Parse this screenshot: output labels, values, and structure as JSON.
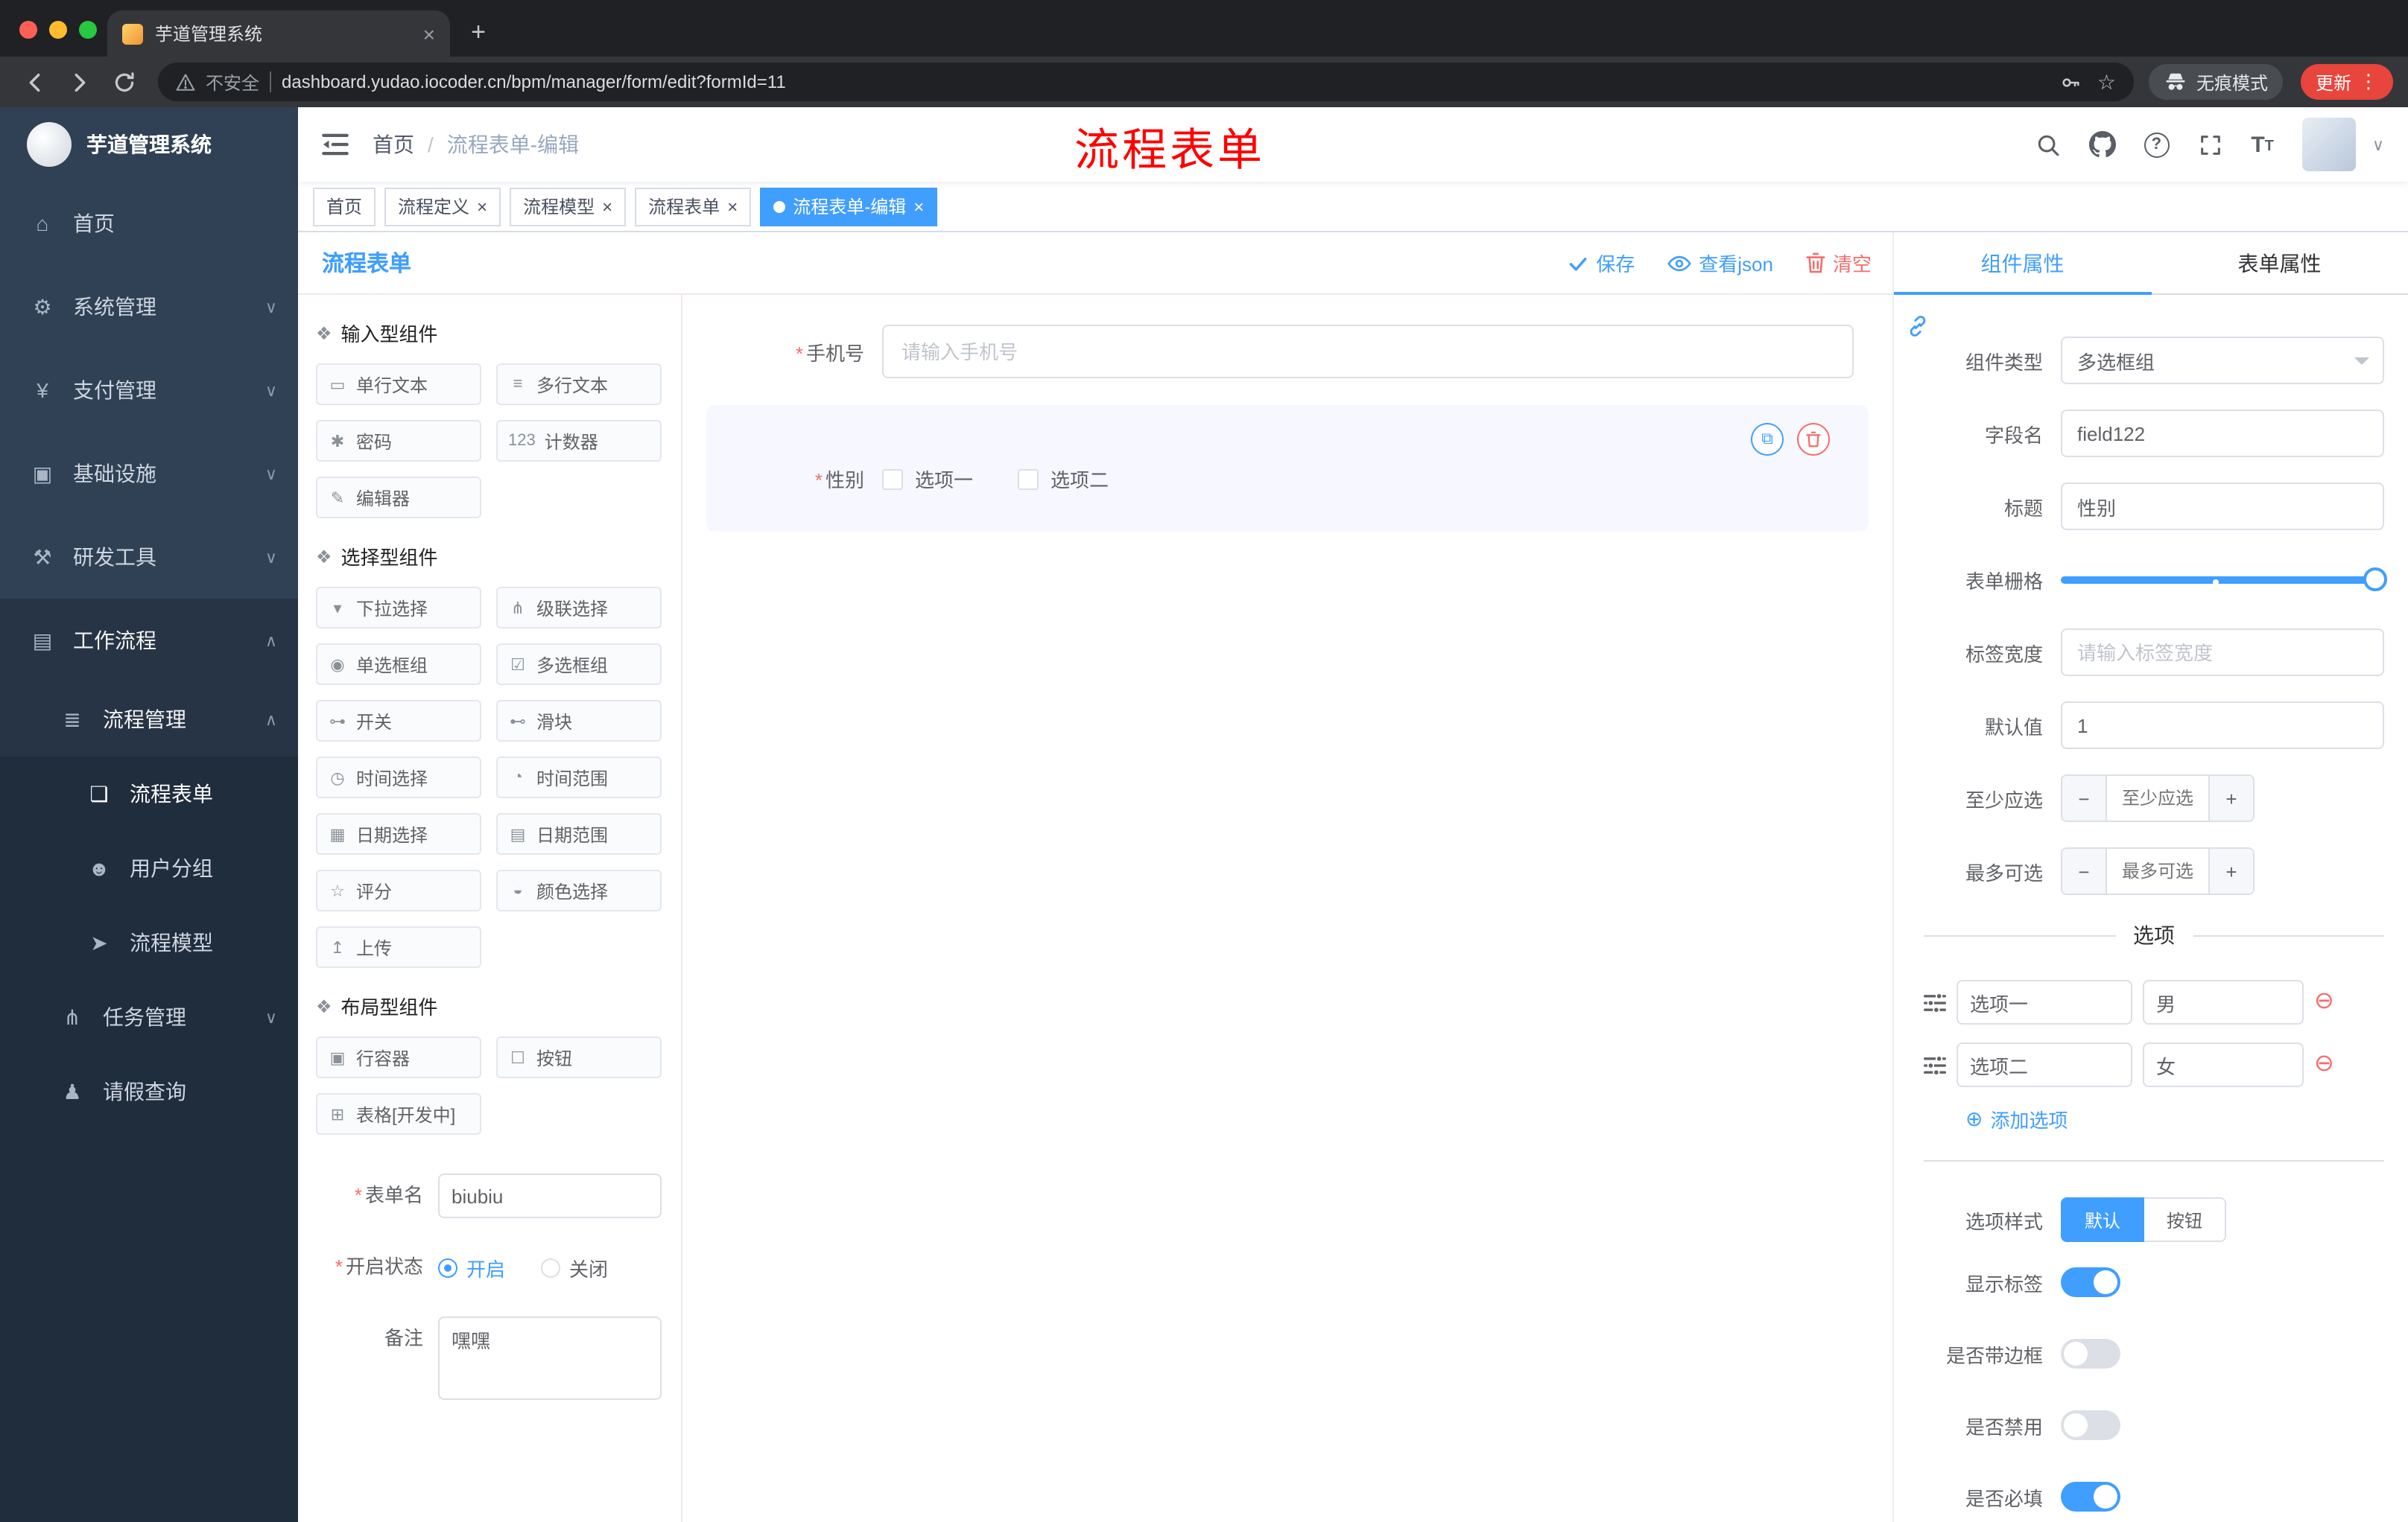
{
  "chrome": {
    "tab_title": "芋道管理系统",
    "security_label": "不安全",
    "url": "dashboard.yudao.iocoder.cn/bpm/manager/form/edit?formId=11",
    "incognito_label": "无痕模式",
    "update_label": "更新"
  },
  "annotation": {
    "text": "流程表单"
  },
  "header": {
    "breadcrumb": [
      "首页",
      "流程表单-编辑"
    ]
  },
  "tags": [
    {
      "label": "首页",
      "active": false
    },
    {
      "label": "流程定义",
      "active": false
    },
    {
      "label": "流程模型",
      "active": false
    },
    {
      "label": "流程表单",
      "active": false
    },
    {
      "label": "流程表单-编辑",
      "active": true
    }
  ],
  "sidebar": {
    "logo_title": "芋道管理系统",
    "items": [
      {
        "label": "首页",
        "icon": "⌂"
      },
      {
        "label": "系统管理",
        "icon": "⚙"
      },
      {
        "label": "支付管理",
        "icon": "¥"
      },
      {
        "label": "基础设施",
        "icon": "▣"
      },
      {
        "label": "研发工具",
        "icon": "⚒"
      },
      {
        "label": "工作流程",
        "icon": "▤"
      },
      {
        "label": "流程管理",
        "icon": "≣"
      },
      {
        "label": "流程表单",
        "icon": "❏"
      },
      {
        "label": "用户分组",
        "icon": "☻"
      },
      {
        "label": "流程模型",
        "icon": "➤"
      },
      {
        "label": "任务管理",
        "icon": "⋔"
      },
      {
        "label": "请假查询",
        "icon": "♟"
      }
    ]
  },
  "builder": {
    "title": "流程表单",
    "actions": {
      "save": "保存",
      "view_json": "查看json",
      "clear": "清空"
    },
    "palette_groups": [
      {
        "title": "输入型组件",
        "icon": "❖",
        "items": [
          {
            "label": "单行文本",
            "icon": "▭"
          },
          {
            "label": "多行文本",
            "icon": "≡"
          },
          {
            "label": "密码",
            "icon": "✱"
          },
          {
            "label": "计数器",
            "icon": "123"
          },
          {
            "label": "编辑器",
            "icon": "✎"
          }
        ]
      },
      {
        "title": "选择型组件",
        "icon": "❖",
        "items": [
          {
            "label": "下拉选择",
            "icon": "▾"
          },
          {
            "label": "级联选择",
            "icon": "⋔"
          },
          {
            "label": "单选框组",
            "icon": "◉"
          },
          {
            "label": "多选框组",
            "icon": "☑"
          },
          {
            "label": "开关",
            "icon": "⊶"
          },
          {
            "label": "滑块",
            "icon": "⊷"
          },
          {
            "label": "时间选择",
            "icon": "◷"
          },
          {
            "label": "时间范围",
            "icon": "◔"
          },
          {
            "label": "日期选择",
            "icon": "▦"
          },
          {
            "label": "日期范围",
            "icon": "▤"
          },
          {
            "label": "评分",
            "icon": "☆"
          },
          {
            "label": "颜色选择",
            "icon": "◒"
          },
          {
            "label": "上传",
            "icon": "↥"
          }
        ]
      },
      {
        "title": "布局型组件",
        "icon": "❖",
        "items": [
          {
            "label": "行容器",
            "icon": "▣"
          },
          {
            "label": "按钮",
            "icon": "☐"
          },
          {
            "label": "表格[开发中]",
            "icon": "⊞"
          }
        ]
      }
    ],
    "form_meta": {
      "name_label": "表单名",
      "name_value": "biubiu",
      "status_label": "开启状态",
      "status_on": "开启",
      "status_off": "关闭",
      "remark_label": "备注",
      "remark_value": "嘿嘿"
    }
  },
  "canvas": {
    "phone": {
      "label": "手机号",
      "placeholder": "请输入手机号"
    },
    "gender": {
      "label": "性别",
      "options": [
        "选项一",
        "选项二"
      ]
    }
  },
  "props": {
    "tabs": [
      "组件属性",
      "表单属性"
    ],
    "fields": {
      "component_type": {
        "label": "组件类型",
        "value": "多选框组"
      },
      "field_name": {
        "label": "字段名",
        "value": "field122"
      },
      "title": {
        "label": "标题",
        "value": "性别"
      },
      "grid": {
        "label": "表单栅格"
      },
      "label_width": {
        "label": "标签宽度",
        "placeholder": "请输入标签宽度"
      },
      "default_value": {
        "label": "默认值",
        "value": "1"
      },
      "min_select": {
        "label": "至少应选",
        "placeholder": "至少应选"
      },
      "max_select": {
        "label": "最多可选",
        "placeholder": "最多可选"
      }
    },
    "options_divider": "选项",
    "options": [
      {
        "label": "选项一",
        "value": "男"
      },
      {
        "label": "选项二",
        "value": "女"
      }
    ],
    "add_option": "添加选项",
    "option_style": {
      "label": "选项样式",
      "buttons": [
        "默认",
        "按钮"
      ]
    },
    "switches": [
      {
        "label": "显示标签",
        "on": true
      },
      {
        "label": "是否带边框",
        "on": false
      },
      {
        "label": "是否禁用",
        "on": false
      },
      {
        "label": "是否必填",
        "on": true
      }
    ]
  },
  "ui": {
    "close_glyph": "×",
    "plus": "+",
    "minus": "−",
    "breadcrumb_separator": "/",
    "required_marker": "*",
    "chevron_down": "∨",
    "chevron_up": "∧",
    "caret_down": "∨",
    "copy_glyph": "⧉",
    "minus_circle": "⊖",
    "plus_circle": "⊕",
    "star_glyph": "☆",
    "dots_glyph": "⋮",
    "help_glyph": "?",
    "fontsize_glyph": "T"
  },
  "colors": {
    "accent": "#409EFF",
    "danger": "#F56C6C",
    "annotation": "#FF0000",
    "sidebar_bg": "#304156",
    "submenu_bg": "#1f2d3d",
    "chrome_bg": "#35363a"
  }
}
